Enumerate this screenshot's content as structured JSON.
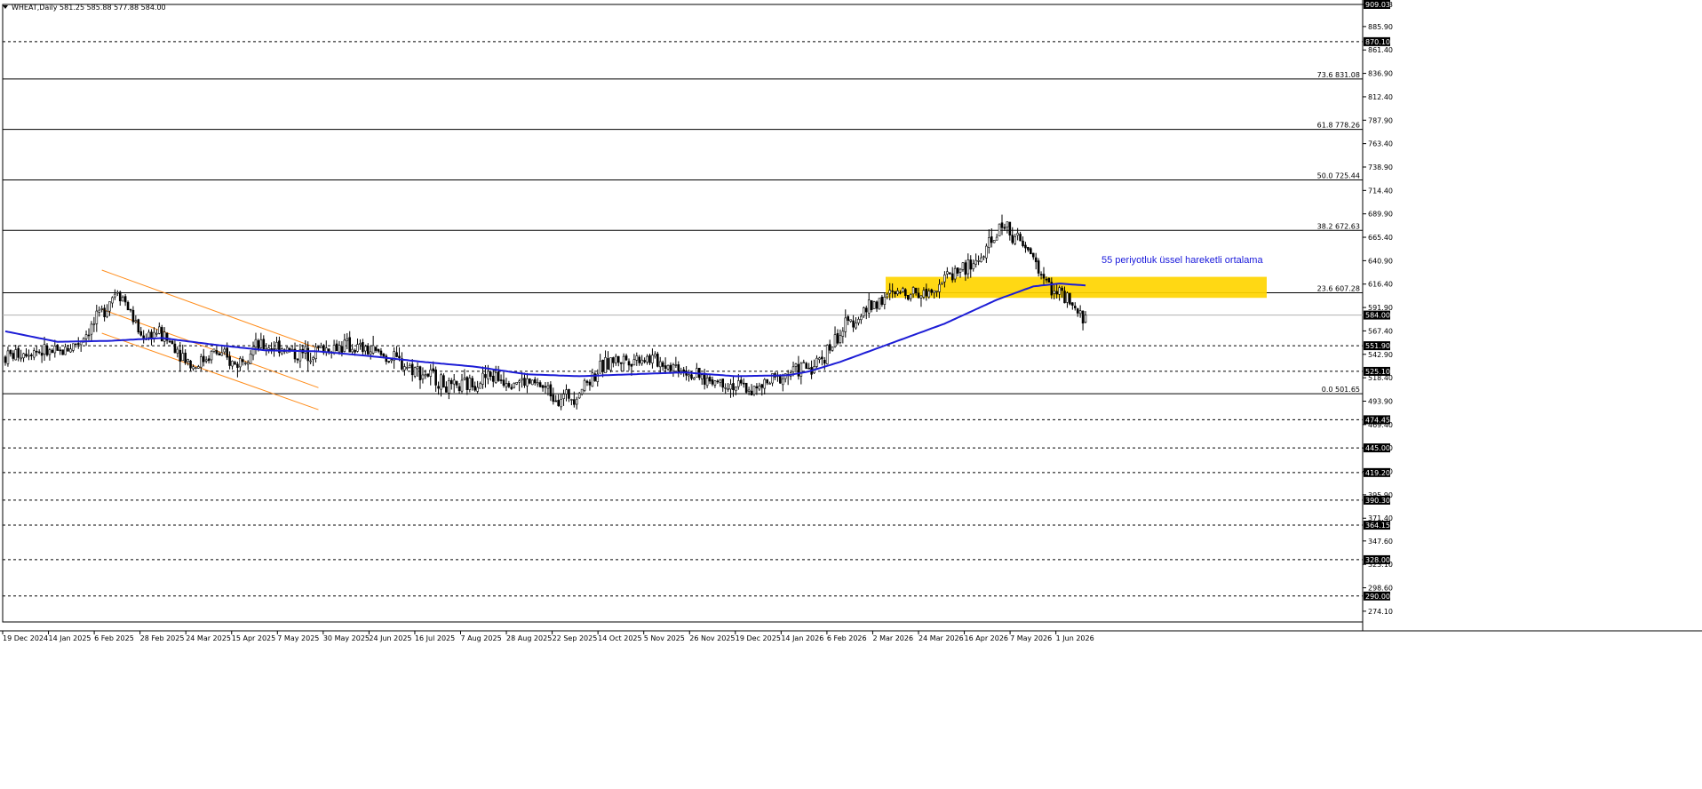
{
  "header": {
    "text": "WHEAT,Daily 581.25 585.88 577.88 584.00"
  },
  "chart_data": {
    "type": "candlestick",
    "symbol": "WHEAT",
    "timeframe": "Daily",
    "ohlc_last": {
      "open": 581.25,
      "high": 585.88,
      "low": 577.88,
      "close": 584.0
    },
    "ylim": [
      274.0,
      909.03
    ],
    "y_ticks": [
      "909.03",
      "885.90",
      "861.40",
      "836.90",
      "812.40",
      "787.90",
      "763.40",
      "738.90",
      "714.40",
      "689.90",
      "665.40",
      "640.90",
      "616.40",
      "591.90",
      "567.40",
      "542.90",
      "518.40",
      "493.90",
      "469.40",
      "444.90",
      "420.40",
      "395.90",
      "371.40",
      "347.60",
      "323.10",
      "298.60",
      "274.10"
    ],
    "x_ticks": [
      "19 Dec 2024",
      "14 Jan 2025",
      "6 Feb 2025",
      "28 Feb 2025",
      "24 Mar 2025",
      "15 Apr 2025",
      "7 May 2025",
      "30 May 2025",
      "24 Jun 2025",
      "16 Jul 2025",
      "7 Aug 2025",
      "28 Aug 2025",
      "22 Sep 2025",
      "14 Oct 2025",
      "5 Nov 2025",
      "26 Nov 2025",
      "19 Dec 2025",
      "14 Jan 2026",
      "6 Feb 2026",
      "2 Mar 2026",
      "24 Mar 2026",
      "16 Apr 2026",
      "7 May 2026",
      "1 Jun 2026"
    ],
    "fibonacci_levels": [
      {
        "label": "73.6 831.08",
        "value": 831.08
      },
      {
        "label": "61.8 778.26",
        "value": 778.26
      },
      {
        "label": "50.0 725.44",
        "value": 725.44
      },
      {
        "label": "38.2 672.63",
        "value": 672.63
      },
      {
        "label": "23.6 607.28",
        "value": 607.28
      },
      {
        "label": "0.0 501.65",
        "value": 501.65
      }
    ],
    "support_resistance_levels": [
      {
        "label": "909.03",
        "value": 909.03
      },
      {
        "label": "870.10",
        "value": 870.1
      },
      {
        "label": "551.90",
        "value": 551.9
      },
      {
        "label": "525.10",
        "value": 525.1
      },
      {
        "label": "474.45",
        "value": 474.45
      },
      {
        "label": "445.00",
        "value": 445.0
      },
      {
        "label": "419.20",
        "value": 419.2
      },
      {
        "label": "390.30",
        "value": 390.3
      },
      {
        "label": "364.15",
        "value": 364.15
      },
      {
        "label": "328.00",
        "value": 328.0
      },
      {
        "label": "290.00",
        "value": 290.0
      }
    ],
    "current_price": {
      "label": "584.00",
      "value": 584.0
    },
    "zone": {
      "low": 602.0,
      "high": 624.0
    },
    "annotation": "55 periyotluk üssel hareketli ortalama",
    "ema_period": 55,
    "price_path": [
      [
        0,
        540
      ],
      [
        10,
        548
      ],
      [
        20,
        543
      ],
      [
        28,
        556
      ],
      [
        35,
        578
      ],
      [
        40,
        600
      ],
      [
        43,
        612
      ],
      [
        46,
        598
      ],
      [
        52,
        562
      ],
      [
        58,
        566
      ],
      [
        65,
        552
      ],
      [
        72,
        530
      ],
      [
        80,
        546
      ],
      [
        88,
        532
      ],
      [
        95,
        550
      ],
      [
        105,
        552
      ],
      [
        112,
        542
      ],
      [
        120,
        548
      ],
      [
        130,
        552
      ],
      [
        140,
        546
      ],
      [
        150,
        536
      ],
      [
        158,
        526
      ],
      [
        165,
        518
      ],
      [
        171,
        505
      ],
      [
        178,
        512
      ],
      [
        185,
        520
      ],
      [
        195,
        516
      ],
      [
        205,
        510
      ],
      [
        212,
        498
      ],
      [
        218,
        500
      ],
      [
        225,
        520
      ],
      [
        232,
        536
      ],
      [
        238,
        538
      ],
      [
        245,
        540
      ],
      [
        252,
        534
      ],
      [
        260,
        528
      ],
      [
        265,
        518
      ],
      [
        275,
        514
      ],
      [
        280,
        510
      ],
      [
        288,
        505
      ],
      [
        292,
        512
      ],
      [
        298,
        520
      ],
      [
        304,
        528
      ],
      [
        310,
        530
      ],
      [
        316,
        550
      ],
      [
        322,
        572
      ],
      [
        328,
        585
      ],
      [
        334,
        598
      ],
      [
        340,
        605
      ],
      [
        346,
        610
      ],
      [
        352,
        606
      ],
      [
        358,
        618
      ],
      [
        364,
        630
      ],
      [
        370,
        635
      ],
      [
        376,
        650
      ],
      [
        382,
        680
      ],
      [
        386,
        670
      ],
      [
        390,
        655
      ],
      [
        394,
        645
      ],
      [
        398,
        620
      ],
      [
        402,
        612
      ],
      [
        406,
        600
      ],
      [
        409,
        590
      ],
      [
        412,
        582
      ],
      [
        414,
        584
      ]
    ],
    "ema_path": [
      [
        0,
        567
      ],
      [
        20,
        556
      ],
      [
        40,
        557
      ],
      [
        60,
        560
      ],
      [
        80,
        553
      ],
      [
        100,
        547
      ],
      [
        120,
        546
      ],
      [
        140,
        541
      ],
      [
        160,
        535
      ],
      [
        180,
        530
      ],
      [
        200,
        522
      ],
      [
        220,
        520
      ],
      [
        240,
        522
      ],
      [
        260,
        524
      ],
      [
        280,
        520
      ],
      [
        300,
        521
      ],
      [
        308,
        525
      ],
      [
        320,
        535
      ],
      [
        340,
        555
      ],
      [
        360,
        575
      ],
      [
        380,
        600
      ],
      [
        394,
        614
      ],
      [
        404,
        617
      ],
      [
        414,
        615
      ]
    ],
    "channel": {
      "upper": [
        [
          37,
          631
        ],
        [
          120,
          549
        ]
      ],
      "middle": [
        [
          37,
          590
        ],
        [
          120,
          508
        ]
      ],
      "lower": [
        [
          37,
          565
        ],
        [
          120,
          485
        ]
      ]
    }
  }
}
